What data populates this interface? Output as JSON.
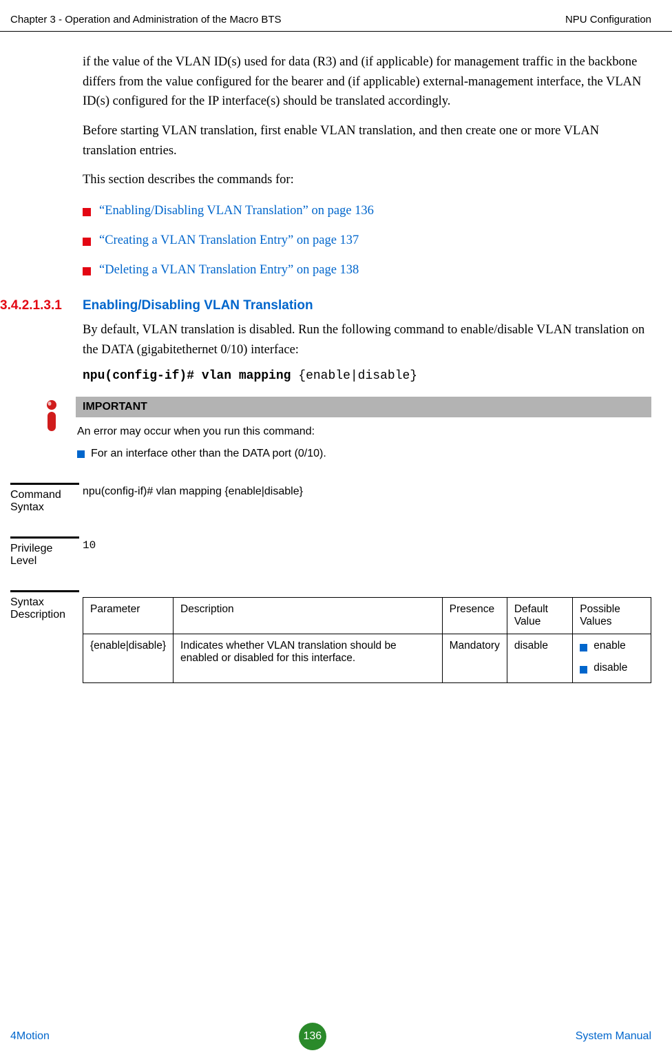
{
  "header": {
    "left": "Chapter 3 - Operation and Administration of the Macro BTS",
    "right": "NPU Configuration"
  },
  "para1": "if the value of the VLAN ID(s) used for data (R3) and (if applicable) for management traffic in the backbone differs from the value configured for the bearer and (if applicable) external-management interface, the VLAN ID(s) configured for the IP interface(s) should be translated accordingly.",
  "para2": "Before starting VLAN translation, first enable VLAN translation, and then create one or more VLAN translation entries.",
  "para3": "This section describes the commands for:",
  "links": [
    "“Enabling/Disabling VLAN Translation” on page 136",
    "“Creating a VLAN Translation Entry” on page 137",
    "“Deleting a VLAN Translation Entry” on page 138"
  ],
  "section": {
    "num": "3.4.2.1.3.1",
    "title": "Enabling/Disabling VLAN Translation"
  },
  "section_para": "By default, VLAN translation is disabled. Run the following command to enable/disable VLAN translation on the DATA (gigabitethernet 0/10) interface:",
  "code": {
    "bold": "npu(config-if)# vlan mapping ",
    "rest": "{enable|disable}"
  },
  "important": {
    "label": "IMPORTANT",
    "text": "An error may occur when you run this command:",
    "item": "For an interface other than the DATA port (0/10)."
  },
  "cmd_syntax": {
    "label": "Command Syntax",
    "value": "npu(config-if)# vlan mapping {enable|disable}"
  },
  "privilege": {
    "label": "Privilege Level",
    "value": "10"
  },
  "syntax_desc": {
    "label": "Syntax Description",
    "headers": [
      "Parameter",
      "Description",
      "Presence",
      "Default Value",
      "Possible Values"
    ],
    "row": {
      "param": "{enable|disable}",
      "desc": "Indicates whether VLAN translation should be enabled or disabled for this interface.",
      "presence": "Mandatory",
      "default": "disable",
      "values": [
        "enable",
        "disable"
      ]
    }
  },
  "footer": {
    "left": "4Motion",
    "page": "136",
    "right": "System Manual"
  }
}
